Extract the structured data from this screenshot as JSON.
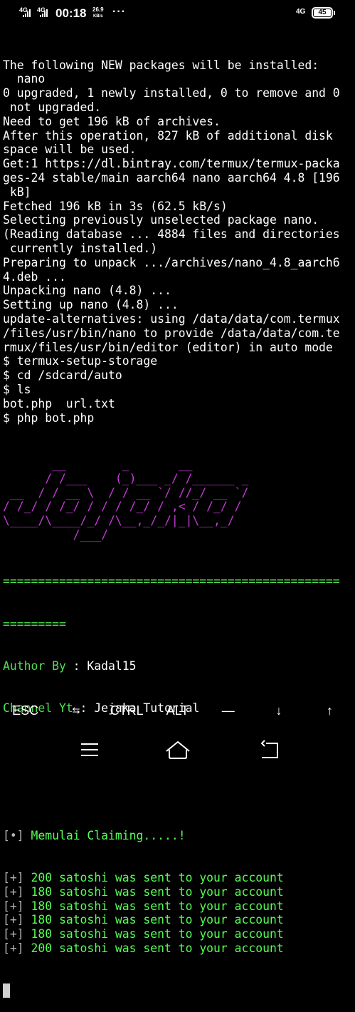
{
  "status_bar": {
    "net1": "4G",
    "net2": "4G",
    "time": "00:18",
    "speed_value": "26.9",
    "speed_unit": "KB/s",
    "more": "···",
    "net_right": "4G",
    "battery": "45"
  },
  "terminal": {
    "lines": [
      "The following NEW packages will be installed:",
      "  nano",
      "0 upgraded, 1 newly installed, 0 to remove and 0",
      " not upgraded.",
      "Need to get 196 kB of archives.",
      "After this operation, 827 kB of additional disk",
      "space will be used.",
      "Get:1 https://dl.bintray.com/termux/termux-packa",
      "ges-24 stable/main aarch64 nano aarch64 4.8 [196",
      " kB]",
      "Fetched 196 kB in 3s (62.5 kB/s)",
      "Selecting previously unselected package nano.",
      "(Reading database ... 4884 files and directories",
      " currently installed.)",
      "Preparing to unpack .../archives/nano_4.8_aarch6",
      "4.deb ...",
      "Unpacking nano (4.8) ...",
      "Setting up nano (4.8) ...",
      "update-alternatives: using /data/data/com.termux",
      "/files/usr/bin/nano to provide /data/data/com.te",
      "rmux/files/usr/bin/editor (editor) in auto mode",
      "$ termux-setup-storage",
      "$ cd /sdcard/auto",
      "$ ls",
      "bot.php  url.txt",
      "$ php bot.php"
    ],
    "ascii_art": [
      "       __        _       __",
      "      / /___    (_)___ _/ /______ _",
      " __  / / __ \\  / / __ `/ //_/ __ `/",
      "/ /_/ / /_/ / / / /_/ / ,< / /_/ /",
      "\\____/\\____/_/ /\\__,_/_/|_|\\__,_/",
      "          /___/"
    ],
    "separator": "================================================",
    "separator_tail": "=========",
    "author_label": "Author By",
    "author_sep": " : ",
    "author_value": "Kadal15",
    "channel_label": "Channel Yt",
    "channel_sep": " : ",
    "channel_value": "Jejaka Tutorial",
    "claim_marker": "[•]",
    "claim_text": "Memulai Claiming.....!",
    "results": [
      {
        "marker": "[+]",
        "text": "200 satoshi was sent to your account"
      },
      {
        "marker": "[+]",
        "text": "180 satoshi was sent to your account"
      },
      {
        "marker": "[+]",
        "text": "180 satoshi was sent to your account"
      },
      {
        "marker": "[+]",
        "text": "180 satoshi was sent to your account"
      },
      {
        "marker": "[+]",
        "text": "180 satoshi was sent to your account"
      },
      {
        "marker": "[+]",
        "text": "200 satoshi was sent to your account"
      }
    ]
  },
  "extra_keys": {
    "esc": "ESC",
    "tab": "⇆",
    "ctrl": "CTRL",
    "alt": "ALT",
    "dash": "—",
    "down": "↓",
    "up": "↑"
  },
  "colors": {
    "background": "#000000",
    "text": "#ffffff",
    "green": "#4ee04e",
    "ascii": "#c33ad6"
  },
  "icons": {
    "menu": "menu-icon",
    "home": "home-icon",
    "back": "back-icon"
  }
}
